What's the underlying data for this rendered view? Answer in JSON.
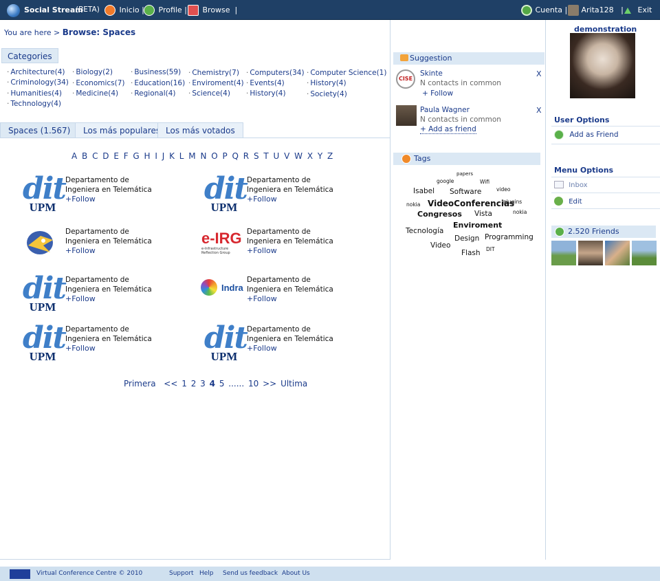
{
  "topbar": {
    "app_name": "Social Stream",
    "beta": "(BETA)",
    "nav": [
      {
        "label": "Inicio",
        "icon": "home-icon"
      },
      {
        "label": "Profile",
        "icon": "user-icon"
      },
      {
        "label": "Browse",
        "icon": "browse-icon"
      }
    ],
    "cuenta": "Cuenta",
    "user": "Arita128",
    "exit": "Exit"
  },
  "breadcrumb": {
    "prefix": "You are here >",
    "current": "Browse: Spaces"
  },
  "categories": {
    "title": "Categories",
    "items": [
      "Architecture(4)",
      "Biology(2)",
      "Business(59)",
      "Chemistry(7)",
      "Computers(34)",
      "Computer Science(1)",
      "Criminology(34)",
      "Economics(7)",
      "Education(16)",
      "Enviroment(4)",
      "Events(4)",
      "History(4)",
      "Humanities(4)",
      "Medicine(4)",
      "Regional(4)",
      "Science(4)",
      "History(4)",
      "Society(4)",
      "Technology(4)"
    ]
  },
  "tabs": [
    "Spaces (1.567)",
    "Los más populares",
    "Los más votados"
  ],
  "letters": "A B C D E F G H I J K L M N O P Q R S T U V W X Y Z",
  "spaces": [
    {
      "line1": "Departamento de",
      "line2": "Ingeniera en Telemática",
      "follow": "+Follow",
      "logo": "dit"
    },
    {
      "line1": "Departamento de",
      "line2": "Ingeniera en Telemática",
      "follow": "+Follow",
      "logo": "dit"
    },
    {
      "line1": "Departamento de",
      "line2": "Ingeniera en Telemática",
      "follow": "+Follow",
      "logo": "bird"
    },
    {
      "line1": "Departamento de",
      "line2": "Ingeniera en Telemática",
      "follow": "+Follow",
      "logo": "eirg"
    },
    {
      "line1": "Departamento de",
      "line2": "Ingeniera en Telemática",
      "follow": "+Follow",
      "logo": "dit"
    },
    {
      "line1": "Departamento de",
      "line2": "Ingeniera en Telemática",
      "follow": "+Follow",
      "logo": "indra"
    },
    {
      "line1": "Departamento de",
      "line2": "Ingeniera en Telemática",
      "follow": "+Follow",
      "logo": "dit"
    },
    {
      "line1": "Departamento de",
      "line2": "Ingeniera en Telemática",
      "follow": "+Follow",
      "logo": "dit"
    }
  ],
  "logos": {
    "dit_word": "dit",
    "upm_word": "UPM",
    "eirg_word": "e-IRG",
    "eirg_sub": "e-Infrastructure Reflection Group",
    "indra_word": "Indra"
  },
  "pager": {
    "first": "Primera",
    "prev": "<<",
    "pages": [
      "1",
      "2",
      "3",
      "4",
      "5"
    ],
    "current": "4",
    "ellipsis": "......",
    "last_page": "10",
    "next": ">>",
    "last": "Ultima"
  },
  "suggestion": {
    "title": "Suggestion",
    "items": [
      {
        "name": "Skinte",
        "common": "N contacts in common",
        "action": "+ Follow",
        "close": "X",
        "avatar_text": "CISE"
      },
      {
        "name": "Paula Wagner",
        "common": "N contacts in common",
        "action": "+ Add as friend",
        "close": "X"
      }
    ]
  },
  "tags": {
    "title": "Tags",
    "items": [
      "papers",
      "google",
      "Wifi",
      "Isabel",
      "Software",
      "video",
      "nokia",
      "VideoConferencias",
      "plugins",
      "Congresos",
      "Vista",
      "nokia",
      "Tecnología",
      "Enviroment",
      "Design",
      "Programming",
      "Video",
      "Flash",
      "DIT"
    ]
  },
  "profile": {
    "name": "demonstration"
  },
  "user_options": {
    "title": "User Options",
    "items": [
      "Add as Friend"
    ]
  },
  "menu_options": {
    "title": "Menu Options",
    "items": [
      "Inbox",
      "Edit"
    ]
  },
  "friends": {
    "label": "2.520 Friends"
  },
  "footer": {
    "copyright": "Virtual Conference Centre © 2010",
    "links": [
      "Support",
      "Help",
      "Send us feedback",
      "About Us"
    ]
  },
  "colors": {
    "topbar": "#1f4066",
    "link": "#1a3a8a",
    "tab_bg": "#dde9f4",
    "footer": "#cfe0ef"
  }
}
